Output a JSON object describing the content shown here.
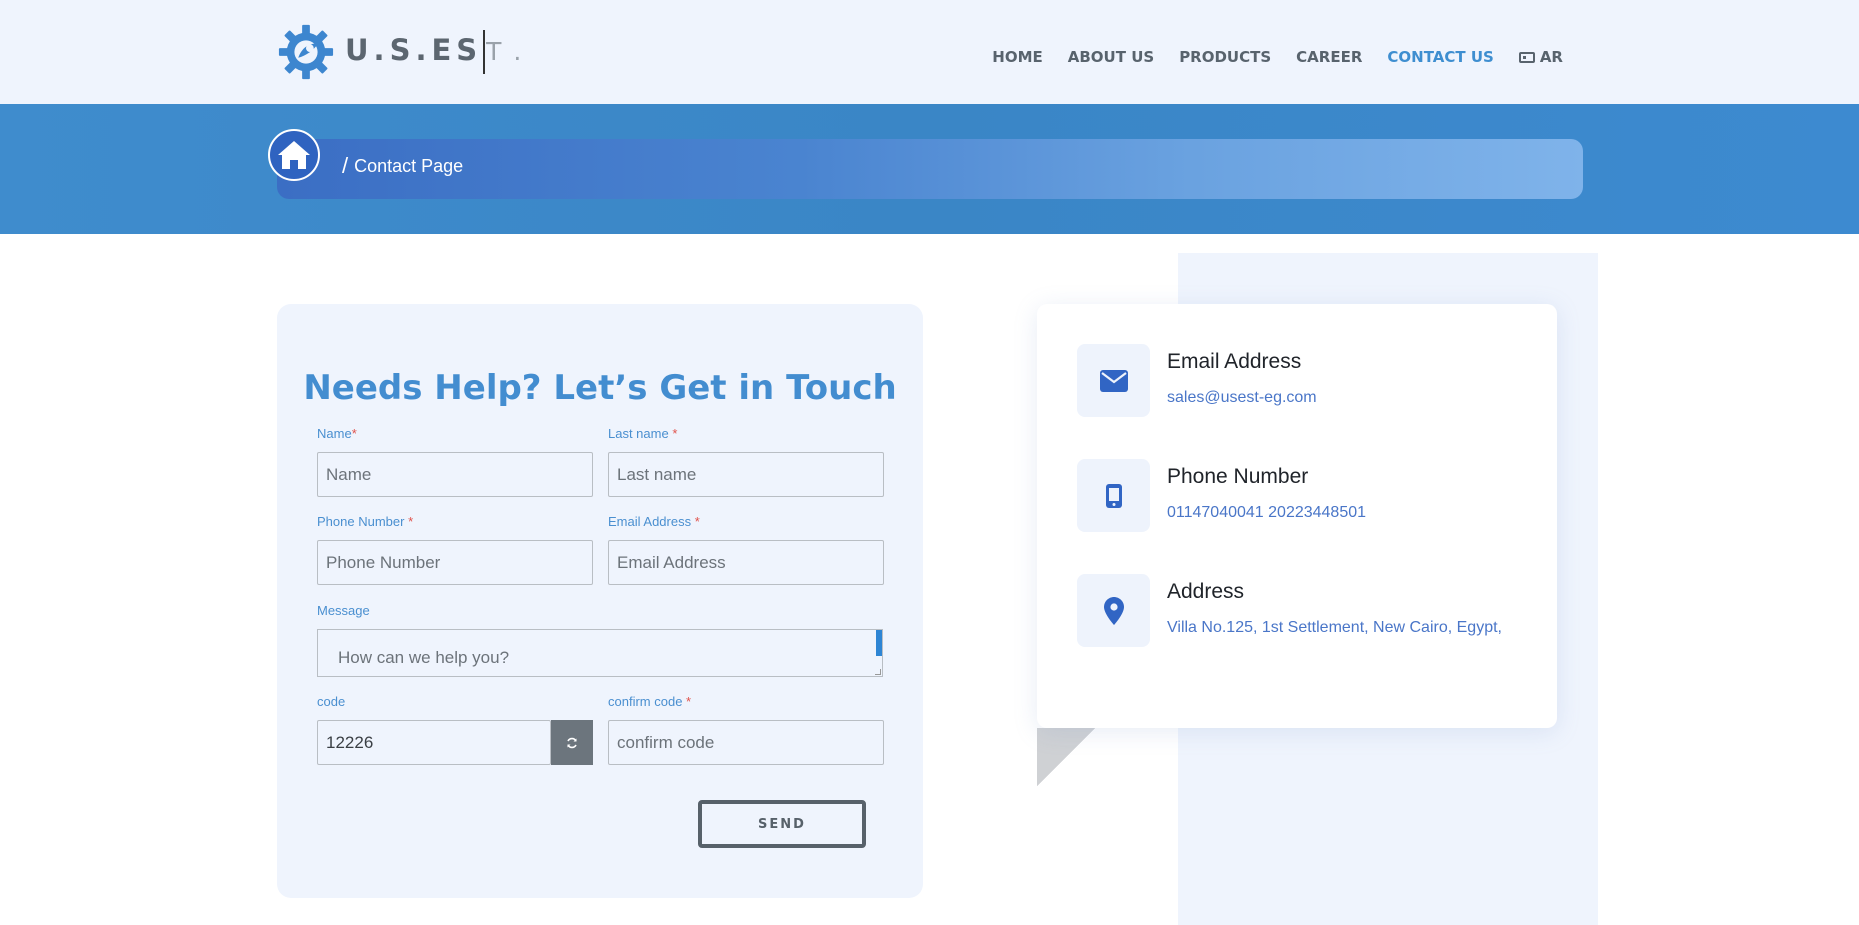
{
  "header": {
    "logo_text": "U.S.ES",
    "logo_tail": "T .",
    "nav": [
      {
        "label": "HOME"
      },
      {
        "label": "ABOUT US"
      },
      {
        "label": "PRODUCTS"
      },
      {
        "label": "CAREER"
      },
      {
        "label": "CONTACT US",
        "active": true
      }
    ],
    "lang_label": "AR"
  },
  "breadcrumb": {
    "separator": "/",
    "current": "Contact Page"
  },
  "form": {
    "title": "Needs Help? Let’s Get in Touch",
    "name": {
      "label": "Name",
      "req": "*",
      "placeholder": "Name"
    },
    "last_name": {
      "label": "Last name ",
      "req": "*",
      "placeholder": "Last name"
    },
    "phone": {
      "label": "Phone Number ",
      "req": "*",
      "placeholder": "Phone Number"
    },
    "email": {
      "label": "Email Address ",
      "req": "*",
      "placeholder": "Email Address"
    },
    "message": {
      "label": "Message",
      "placeholder": "How can we help you?"
    },
    "code": {
      "label": "code",
      "value": "12226"
    },
    "confirm_code": {
      "label": "confirm code ",
      "req": "*",
      "placeholder": "confirm code"
    },
    "send_label": "SEND"
  },
  "contact": {
    "email": {
      "title": "Email Address",
      "value": "sales@usest-eg.com"
    },
    "phone": {
      "title": "Phone Number",
      "value": "01147040041 20223448501"
    },
    "address": {
      "title": "Address",
      "value": "Villa No.125, 1st Settlement, New Cairo, Egypt,"
    }
  },
  "colors": {
    "accent": "#438dd0",
    "banner": "#3f8ccd",
    "nav_active": "#3e8ed0",
    "icon": "#3165c4",
    "required": "#e0524b"
  }
}
